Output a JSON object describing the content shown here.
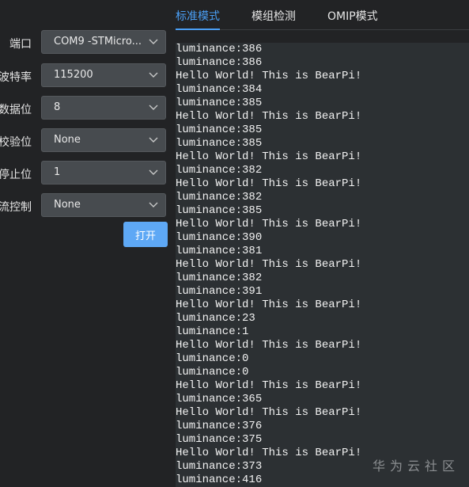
{
  "settings": [
    {
      "label": "端口",
      "value": "COM9 -STMicro..."
    },
    {
      "label": "波特率",
      "value": "115200"
    },
    {
      "label": "数据位",
      "value": "8"
    },
    {
      "label": "校验位",
      "value": "None"
    },
    {
      "label": "停止位",
      "value": "1"
    },
    {
      "label": "流控制",
      "value": "None"
    }
  ],
  "open_button": "打开",
  "tabs": [
    "标准模式",
    "模组检测",
    "OMIP模式"
  ],
  "console_lines": [
    "luminance:386",
    "luminance:386",
    "Hello World! This is BearPi!",
    "luminance:384",
    "luminance:385",
    "Hello World! This is BearPi!",
    "luminance:385",
    "luminance:385",
    "Hello World! This is BearPi!",
    "luminance:382",
    "Hello World! This is BearPi!",
    "luminance:382",
    "luminance:385",
    "Hello World! This is BearPi!",
    "luminance:390",
    "luminance:381",
    "Hello World! This is BearPi!",
    "luminance:382",
    "luminance:391",
    "Hello World! This is BearPi!",
    "luminance:23",
    "luminance:1",
    "Hello World! This is BearPi!",
    "luminance:0",
    "luminance:0",
    "Hello World! This is BearPi!",
    "luminance:365",
    "Hello World! This is BearPi!",
    "luminance:376",
    "luminance:375",
    "Hello World! This is BearPi!",
    "luminance:373",
    "luminance:416"
  ],
  "watermark": "华为云社区",
  "colors": {
    "accent": "#4a9ff5",
    "button": "#5ea8f5",
    "console_bg": "#2c3033"
  }
}
